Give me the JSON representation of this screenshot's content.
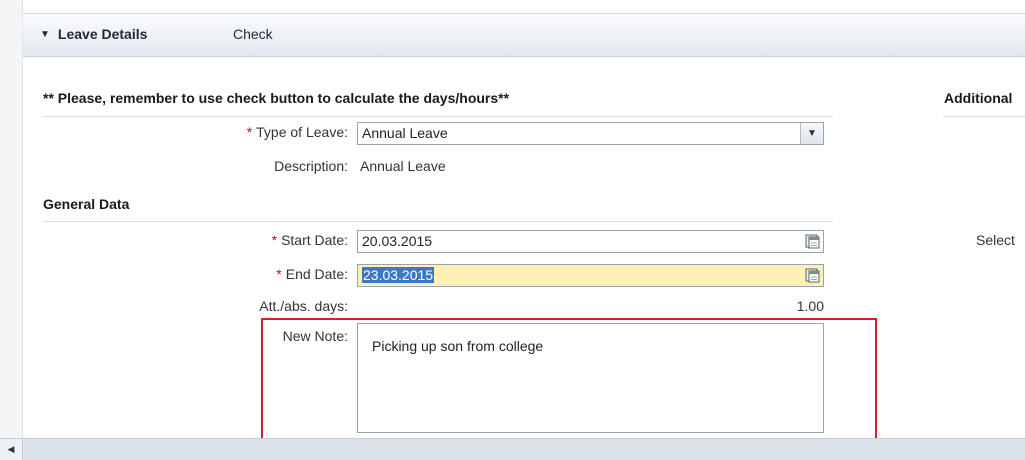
{
  "tabs": {
    "leave_details": "Leave Details",
    "check": "Check"
  },
  "reminder": "** Please, remember to use check button to calculate the days/hours**",
  "additional_header": "Additional",
  "type_of_leave": {
    "label": "Type of Leave:",
    "value": "Annual Leave"
  },
  "description": {
    "label": "Description:",
    "value": "Annual Leave"
  },
  "general_data_title": "General Data",
  "start_date": {
    "label": "Start Date:",
    "value": "20.03.2015"
  },
  "end_date": {
    "label": "End Date:",
    "value": "23.03.2015"
  },
  "att_abs_days": {
    "label": "Att./abs. days:",
    "value": "1.00"
  },
  "new_note": {
    "label": "New Note:",
    "value": "Picking up son from college"
  },
  "select_label": "Select",
  "required_marker": "*",
  "colors": {
    "required": "#d0021b",
    "highlight_box": "#d31f25",
    "field_highlight": "#fdf1b3",
    "selection": "#3d78c6"
  }
}
